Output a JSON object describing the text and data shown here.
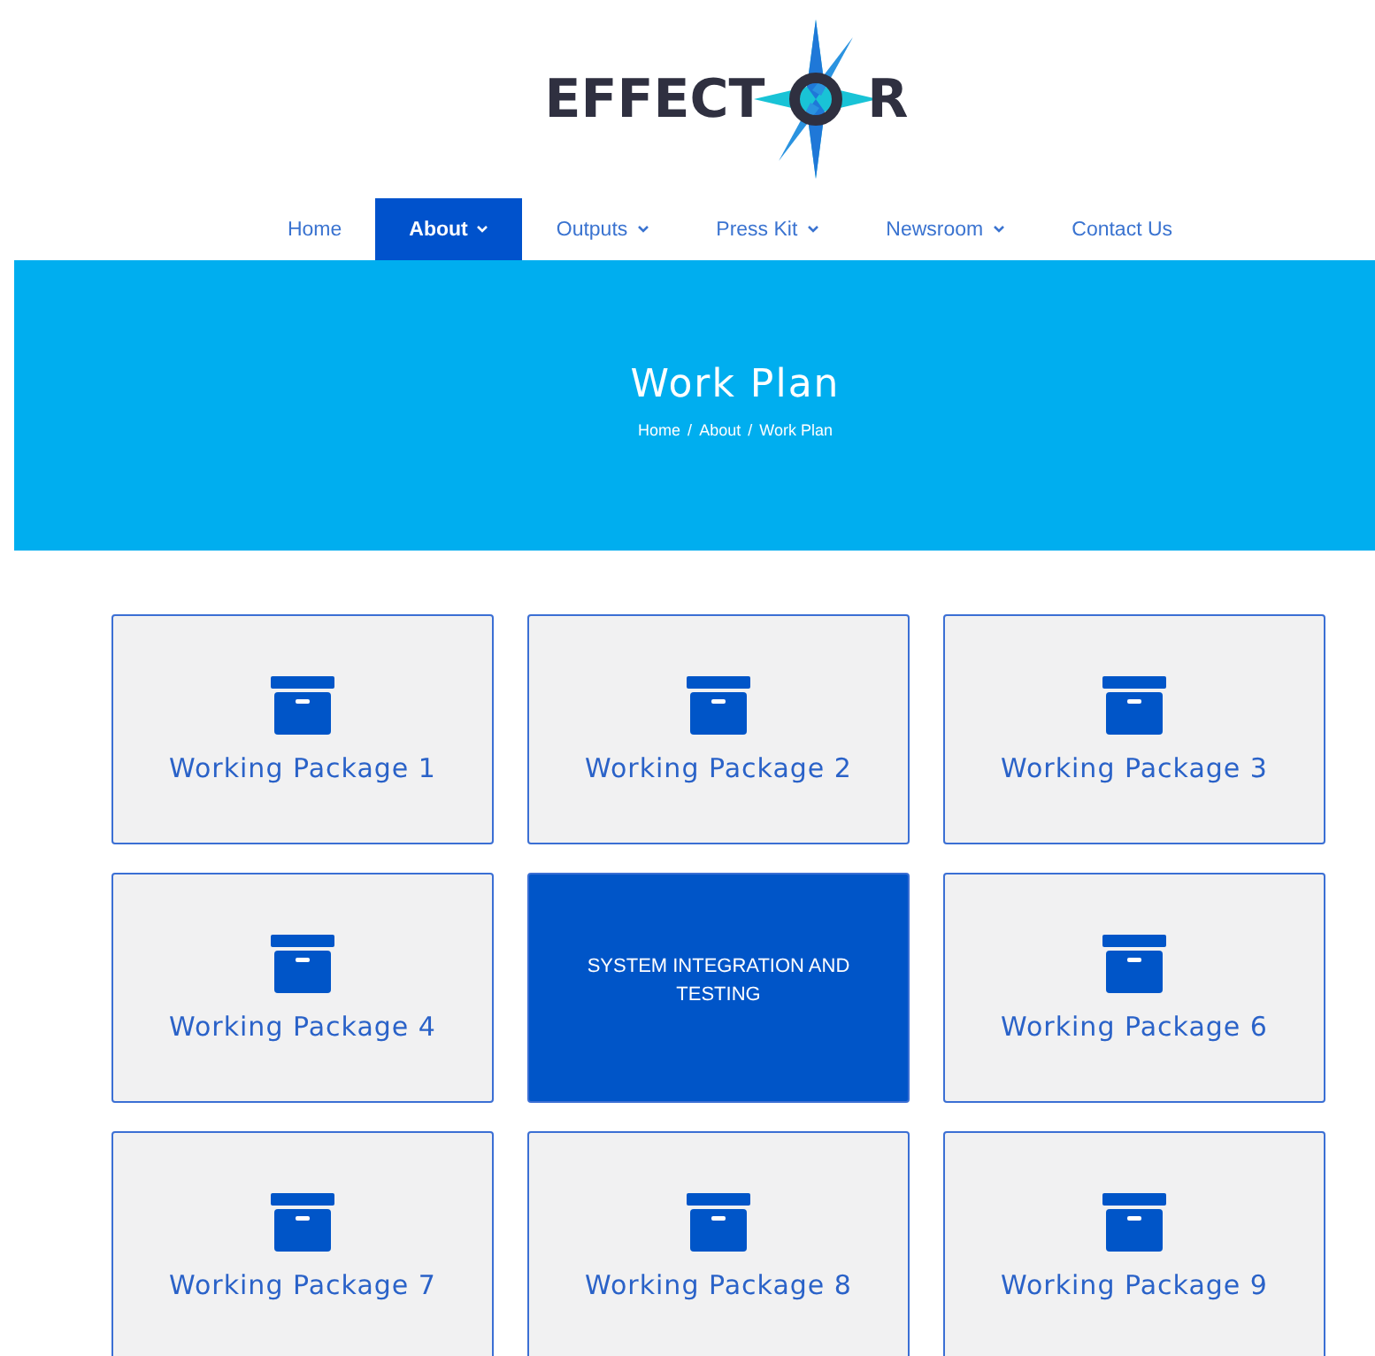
{
  "logo": {
    "text_before": "EFFECT",
    "text_after": "R"
  },
  "nav": [
    {
      "label": "Home",
      "selected": false,
      "has_menu": false
    },
    {
      "label": "About",
      "selected": true,
      "has_menu": true
    },
    {
      "label": "Outputs",
      "selected": false,
      "has_menu": true
    },
    {
      "label": "Press Kit",
      "selected": false,
      "has_menu": true
    },
    {
      "label": "Newsroom",
      "selected": false,
      "has_menu": true
    },
    {
      "label": "Contact Us",
      "selected": false,
      "has_menu": false
    }
  ],
  "hero": {
    "title": "Work Plan",
    "breadcrumb": {
      "separator": "/",
      "items": [
        "Home",
        "About",
        "Work Plan"
      ]
    }
  },
  "card_rows": [
    {
      "cards": [
        {
          "title": "Working Package 1",
          "hovered": false
        },
        {
          "title": "Working Package 2",
          "hovered": false
        },
        {
          "title": "Working Package 3",
          "hovered": false
        }
      ]
    },
    {
      "cards": [
        {
          "title": "Working Package 4",
          "hovered": false
        },
        {
          "description": "SYSTEM INTEGRATION AND TESTING",
          "hovered": true
        },
        {
          "title": "Working Package 6",
          "hovered": false
        }
      ]
    },
    {
      "cards": [
        {
          "title": "Working Package 7",
          "hovered": false
        },
        {
          "title": "Working Package 8",
          "hovered": false
        },
        {
          "title": "Working Package 9",
          "hovered": false
        }
      ]
    }
  ]
}
